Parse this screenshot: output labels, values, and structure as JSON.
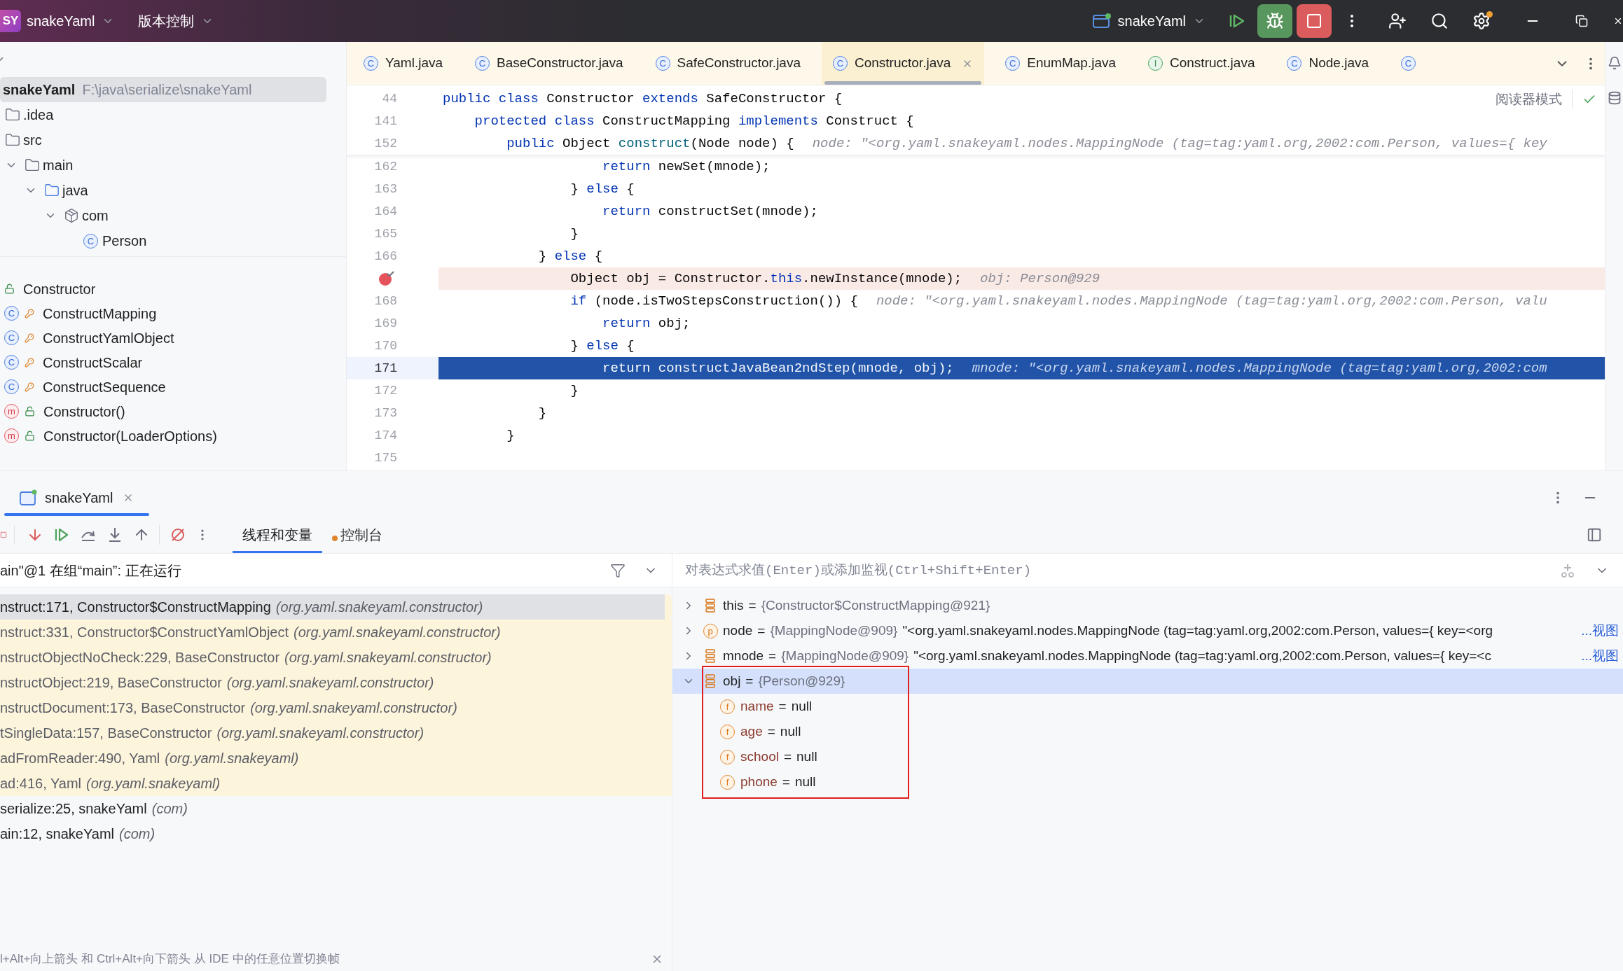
{
  "title_bar": {
    "project_badge": "SY",
    "project": "snakeYaml",
    "vcs": "版本控制",
    "run_config": "snakeYaml"
  },
  "project": {
    "tree": [
      {
        "name": "snakeYaml",
        "path": "F:\\java\\serialize\\snakeYaml",
        "selected": true,
        "children": [
          {
            "name": ".idea",
            "selected": false
          },
          {
            "name": "src",
            "selected": false,
            "children": [
              {
                "name": "main",
                "selected": false,
                "expanded": true,
                "children": [
                  {
                    "name": "java",
                    "selected": false,
                    "expanded": true,
                    "children": [
                      {
                        "name": "com",
                        "selected": false,
                        "expanded": true,
                        "children": [
                          {
                            "name": "Person",
                            "selected": false,
                            "badge": "C"
                          }
                        ]
                      }
                    ]
                  }
                ]
              }
            ]
          }
        ]
      }
    ]
  },
  "structure": [
    {
      "kind": "root",
      "protected": false,
      "name": "Constructor"
    },
    {
      "kind": "class",
      "badge": "C",
      "protected": true,
      "name": "ConstructMapping"
    },
    {
      "kind": "class",
      "badge": "C",
      "protected": true,
      "name": "ConstructYamlObject"
    },
    {
      "kind": "class",
      "badge": "C",
      "protected": true,
      "name": "ConstructScalar"
    },
    {
      "kind": "class",
      "badge": "C",
      "protected": true,
      "name": "ConstructSequence"
    },
    {
      "kind": "method",
      "badge": "m",
      "protected": false,
      "name": "Constructor()"
    },
    {
      "kind": "method",
      "badge": "m",
      "protected": false,
      "name": "Constructor(LoaderOptions)"
    }
  ],
  "editor": {
    "tabs": [
      {
        "kind": "class",
        "badge": "C",
        "label": "Yaml.java",
        "selected": false
      },
      {
        "kind": "class",
        "badge": "C",
        "label": "BaseConstructor.java",
        "selected": false
      },
      {
        "kind": "class",
        "badge": "C",
        "label": "SafeConstructor.java",
        "selected": false
      },
      {
        "kind": "class",
        "badge": "C",
        "label": "Constructor.java",
        "selected": true
      },
      {
        "kind": "class",
        "badge": "C",
        "label": "EnumMap.java",
        "selected": false
      },
      {
        "kind": "interface",
        "badge": "I",
        "label": "Construct.java",
        "selected": false
      },
      {
        "kind": "class",
        "badge": "C",
        "label": "Node.java",
        "selected": false
      },
      {
        "kind": "class",
        "badge": "C",
        "selected": false
      }
    ],
    "reader_mode": "阅读器模式",
    "lines": [
      {
        "kind": "sticky",
        "number": "44",
        "code": [
          {
            "t": "public class ",
            "kind": "kw"
          },
          {
            "t": "Constructor ",
            "kind": "id"
          },
          {
            "t": "extends ",
            "kind": "kw"
          },
          {
            "t": "SafeConstructor {",
            "kind": "id"
          }
        ]
      },
      {
        "kind": "sticky",
        "number": "141",
        "code": [
          {
            "t": "    protected class ",
            "kind": "kw"
          },
          {
            "t": "ConstructMapping ",
            "kind": "id"
          },
          {
            "t": "implements ",
            "kind": "kw"
          },
          {
            "t": "Construct {",
            "kind": "id"
          }
        ]
      },
      {
        "kind": "sticky",
        "number": "152",
        "code": [
          {
            "t": "        public ",
            "kind": "kw"
          },
          {
            "t": "Object ",
            "kind": "id"
          },
          {
            "t": "construct",
            "kind": "fn"
          },
          {
            "t": "(Node node) {",
            "kind": "id"
          }
        ],
        "hint": "node: \"<org.yaml.snakeyaml.nodes.MappingNode (tag=tag:yaml.org,2002:com.Person, values={ key"
      },
      {
        "kind": "normal",
        "number": "162",
        "code": [
          {
            "t": "                    return ",
            "kind": "kw"
          },
          {
            "t": "newSet(mnode);",
            "kind": "id"
          }
        ]
      },
      {
        "kind": "normal",
        "number": "163",
        "code": [
          {
            "t": "                } ",
            "kind": "id"
          },
          {
            "t": "else ",
            "kind": "kw"
          },
          {
            "t": "{",
            "kind": "id"
          }
        ]
      },
      {
        "kind": "normal",
        "number": "164",
        "code": [
          {
            "t": "                    return ",
            "kind": "kw"
          },
          {
            "t": "constructSet(mnode);",
            "kind": "id"
          }
        ]
      },
      {
        "kind": "normal",
        "number": "165",
        "code": [
          {
            "t": "                }",
            "kind": "id"
          }
        ]
      },
      {
        "kind": "normal",
        "number": "166",
        "code": [
          {
            "t": "            } ",
            "kind": "id"
          },
          {
            "t": "else ",
            "kind": "kw"
          },
          {
            "t": "{",
            "kind": "id"
          }
        ]
      },
      {
        "kind": "breakpoint",
        "code": [
          {
            "t": "                Object obj = Constructor.",
            "kind": "id"
          },
          {
            "t": "this",
            "kind": "kw"
          },
          {
            "t": ".newInstance(mnode);",
            "kind": "id"
          }
        ],
        "hint": "obj: Person@929"
      },
      {
        "kind": "normal",
        "number": "168",
        "code": [
          {
            "t": "                if ",
            "kind": "kw"
          },
          {
            "t": "(node.isTwoStepsConstruction()) {",
            "kind": "id"
          }
        ],
        "hint": "node: \"<org.yaml.snakeyaml.nodes.MappingNode (tag=tag:yaml.org,2002:com.Person, valu"
      },
      {
        "kind": "normal",
        "number": "169",
        "code": [
          {
            "t": "                    return ",
            "kind": "kw"
          },
          {
            "t": "obj;",
            "kind": "id"
          }
        ]
      },
      {
        "kind": "normal",
        "number": "170",
        "code": [
          {
            "t": "                } ",
            "kind": "id"
          },
          {
            "t": "else ",
            "kind": "kw"
          },
          {
            "t": "{",
            "kind": "id"
          }
        ]
      },
      {
        "kind": "current",
        "number": "171",
        "code": [
          {
            "t": "                    return ",
            "kind": "kw"
          },
          {
            "t": "constructJavaBean2ndStep(mnode, obj);",
            "kind": "id"
          }
        ],
        "hint": "mnode: \"<org.yaml.snakeyaml.nodes.MappingNode (tag=tag:yaml.org,2002:com"
      },
      {
        "kind": "normal",
        "number": "172",
        "code": [
          {
            "t": "                }",
            "kind": "id"
          }
        ]
      },
      {
        "kind": "normal",
        "number": "173",
        "code": [
          {
            "t": "            }",
            "kind": "id"
          }
        ]
      },
      {
        "kind": "normal",
        "number": "174",
        "code": [
          {
            "t": "        }",
            "kind": "id"
          }
        ]
      },
      {
        "kind": "normal",
        "number": "175"
      }
    ]
  },
  "debug": {
    "session_tab": "snakeYaml",
    "tabs": [
      {
        "label": "线程和变量",
        "selected": true
      },
      {
        "label": "控制台",
        "selected": false
      }
    ],
    "thread": "ain\"@1 在组“main”: 正在运行",
    "frames": [
      {
        "frame": "nstruct:171, Constructor$ConstructMapping",
        "package": "(org.yaml.snakeyaml.constructor)",
        "selected": true,
        "library": true
      },
      {
        "frame": "nstruct:331, Constructor$ConstructYamlObject",
        "package": "(org.yaml.snakeyaml.constructor)",
        "selected": false,
        "library": true
      },
      {
        "frame": "nstructObjectNoCheck:229, BaseConstructor",
        "package": "(org.yaml.snakeyaml.constructor)",
        "selected": false,
        "library": true
      },
      {
        "frame": "nstructObject:219, BaseConstructor",
        "package": "(org.yaml.snakeyaml.constructor)",
        "selected": false,
        "library": true
      },
      {
        "frame": "nstructDocument:173, BaseConstructor",
        "package": "(org.yaml.snakeyaml.constructor)",
        "selected": false,
        "library": true
      },
      {
        "frame": "tSingleData:157, BaseConstructor",
        "package": "(org.yaml.snakeyaml.constructor)",
        "selected": false,
        "library": true
      },
      {
        "frame": "adFromReader:490, Yaml",
        "package": "(org.yaml.snakeyaml)",
        "selected": false,
        "library": true
      },
      {
        "frame": "ad:416, Yaml",
        "package": "(org.yaml.snakeyaml)",
        "selected": false,
        "library": true
      },
      {
        "frame": "serialize:25, snakeYaml",
        "package": "(com)",
        "selected": false,
        "library": false
      },
      {
        "frame": "ain:12, snakeYaml",
        "package": "(com)",
        "selected": false,
        "library": false
      }
    ],
    "hint": "l+Alt+向上箭头 和 Ctrl+Alt+向下箭头 从 IDE 中的任意位置切换帧",
    "evaluate_placeholder": "对表达式求值(Enter)或添加监视(Ctrl+Shift+Enter)",
    "variables": [
      {
        "kind": "local",
        "name": "this",
        "eq": "=",
        "value": "{Constructor$ConstructMapping@921}",
        "expanded": false,
        "selected": false,
        "highlighted": false
      },
      {
        "kind": "param",
        "badge": "p",
        "name": "node",
        "eq": "=",
        "value": "{MappingNode@909}",
        "text": "\"<org.yaml.snakeyaml.nodes.MappingNode (tag=tag:yaml.org,2002:com.Person, values={ key=<org",
        "link": "...视图",
        "expanded": false,
        "selected": false,
        "highlighted": false
      },
      {
        "kind": "local",
        "name": "mnode",
        "eq": "=",
        "value": "{MappingNode@909}",
        "text": "\"<org.yaml.snakeyaml.nodes.MappingNode (tag=tag:yaml.org,2002:com.Person, values={ key=<c",
        "link": "...视图",
        "expanded": false,
        "selected": false,
        "highlighted": false
      },
      {
        "kind": "local",
        "name": "obj",
        "eq": "=",
        "value": "{Person@929}",
        "expanded": true,
        "selected": true,
        "highlighted": true,
        "children": [
          {
            "kind": "field",
            "badge": "f",
            "name": "name",
            "eq": "=",
            "text": "null"
          },
          {
            "kind": "field",
            "badge": "f",
            "name": "age",
            "eq": "=",
            "text": "null"
          },
          {
            "kind": "field",
            "badge": "f",
            "name": "school",
            "eq": "=",
            "text": "null"
          },
          {
            "kind": "field",
            "badge": "f",
            "name": "phone",
            "eq": "=",
            "text": "null"
          }
        ]
      }
    ]
  }
}
